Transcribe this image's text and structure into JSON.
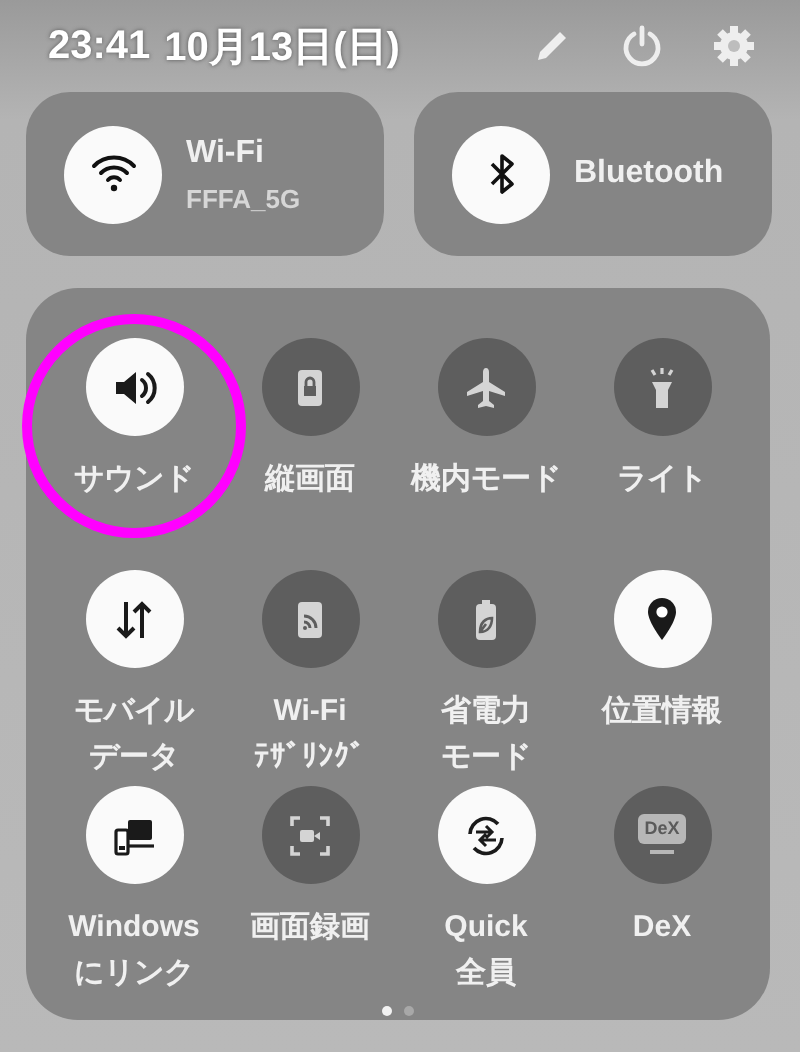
{
  "header": {
    "time": "23:41",
    "date": "10月13日(日)"
  },
  "cards": [
    {
      "kind": "wifi",
      "label": "Wi-Fi",
      "detail": "FFFA_5G",
      "on": true
    },
    {
      "kind": "bluetooth",
      "label": "Bluetooth",
      "on": true
    }
  ],
  "tiles": [
    {
      "kind": "sound",
      "label": [
        "サウンド"
      ],
      "on": true,
      "highlighted": true
    },
    {
      "kind": "rotate",
      "label": [
        "縦画面"
      ],
      "on": false
    },
    {
      "kind": "airplane",
      "label": [
        "機内モード"
      ],
      "on": false
    },
    {
      "kind": "flashlight",
      "label": [
        "ライト"
      ],
      "on": false
    },
    {
      "kind": "data",
      "label": [
        "モバイル",
        "データ"
      ],
      "on": true
    },
    {
      "kind": "hotspot",
      "label": [
        "Wi-Fi",
        "ﾃｻﾞﾘﾝｸﾞ"
      ],
      "on": false
    },
    {
      "kind": "battery",
      "label": [
        "省電力",
        "モード"
      ],
      "on": false
    },
    {
      "kind": "location",
      "label": [
        "位置情報"
      ],
      "on": true
    },
    {
      "kind": "link",
      "label": [
        "Windows",
        "にリンク"
      ],
      "on": true
    },
    {
      "kind": "record",
      "label": [
        "画面録画"
      ],
      "on": false
    },
    {
      "kind": "share",
      "label": [
        "Quick",
        "全員"
      ],
      "on": true
    },
    {
      "kind": "dex",
      "label": [
        "DeX"
      ],
      "badge": "DeX",
      "on": false
    }
  ],
  "pages": [
    {
      "selected": true
    },
    {
      "selected": false
    }
  ]
}
